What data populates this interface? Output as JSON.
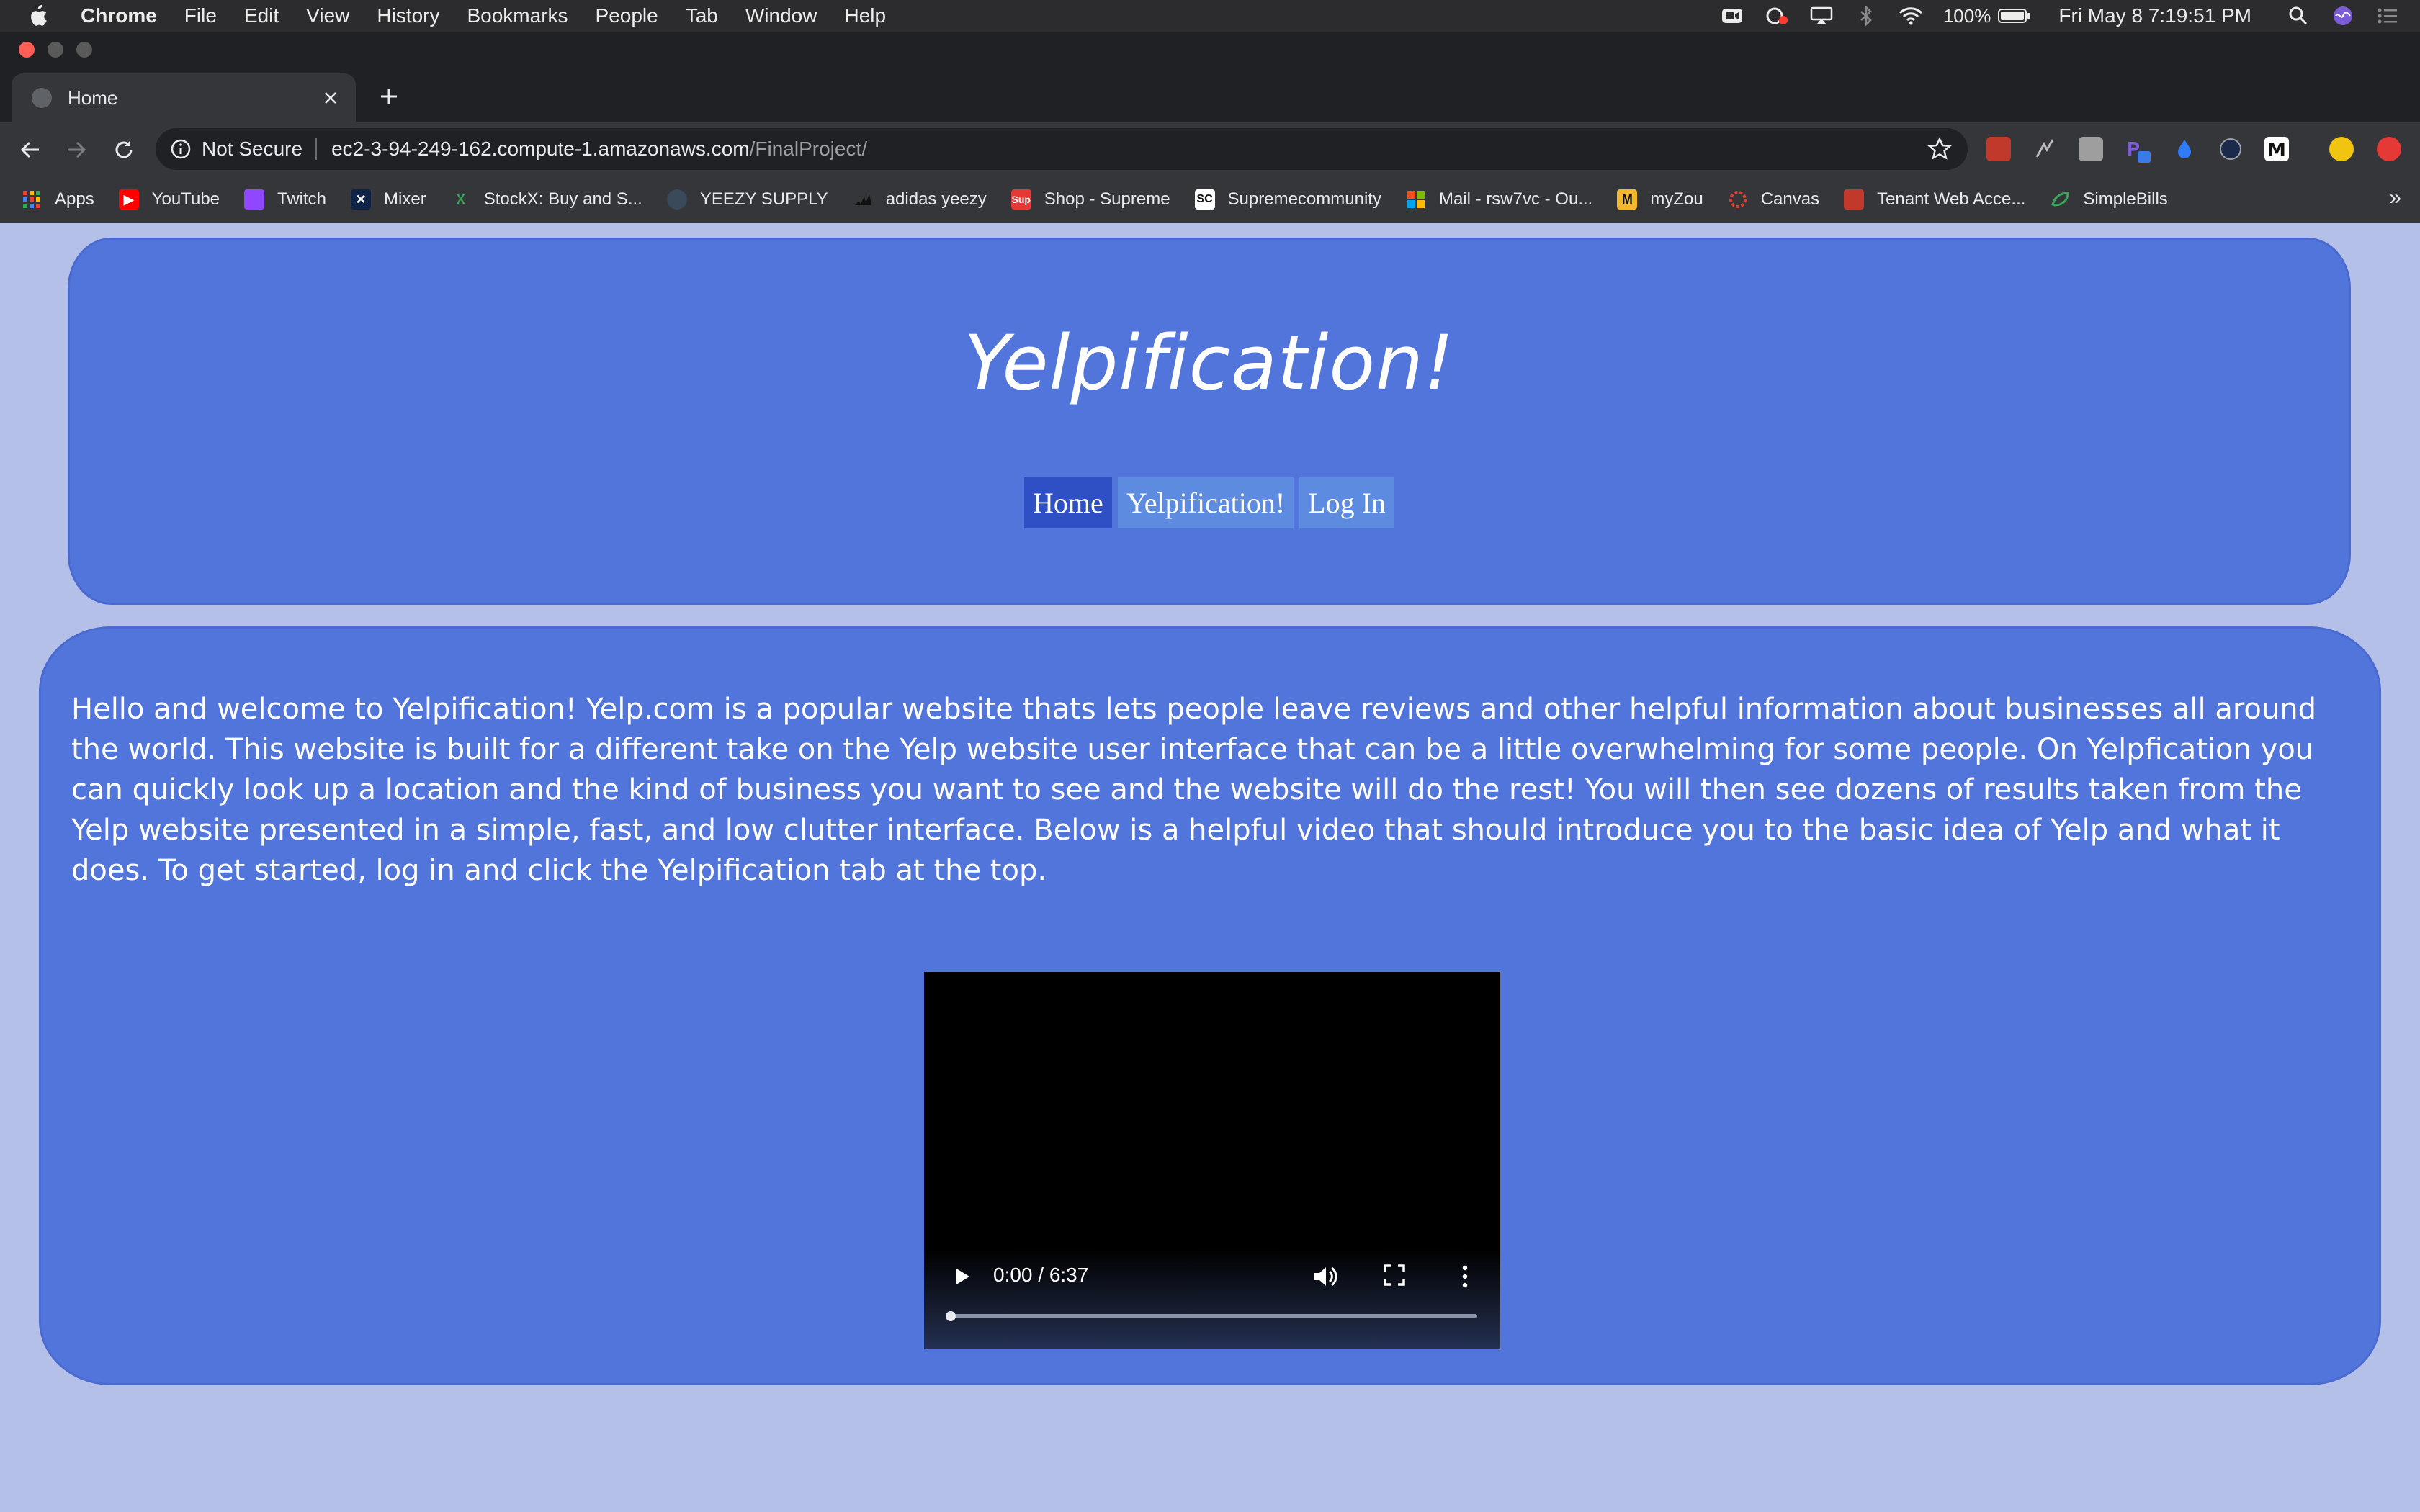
{
  "menubar": {
    "app_name": "Chrome",
    "items": [
      "File",
      "Edit",
      "View",
      "History",
      "Bookmarks",
      "People",
      "Tab",
      "Window",
      "Help"
    ],
    "battery": "100%",
    "clock": "Fri May 8  7:19:51 PM"
  },
  "browser": {
    "tab_title": "Home",
    "security_label": "Not Secure",
    "url_host": "ec2-3-94-249-162.compute-1.amazonaws.com",
    "url_path": "/FinalProject/",
    "bookmarks": [
      {
        "label": "Apps",
        "color": "#e94235"
      },
      {
        "label": "YouTube",
        "color": "#ff0000"
      },
      {
        "label": "Twitch",
        "color": "#9146ff"
      },
      {
        "label": "Mixer",
        "color": "#0f2346"
      },
      {
        "label": "StockX: Buy and S...",
        "color": "#2e7d32"
      },
      {
        "label": "YEEZY SUPPLY",
        "color": "#3b4a5a"
      },
      {
        "label": "adidas yeezy",
        "color": "#111111"
      },
      {
        "label": "Shop - Supreme",
        "color": "#e53935"
      },
      {
        "label": "Supremecommunity",
        "color": "#222222"
      },
      {
        "label": "Mail - rsw7vc - Ou...",
        "color": "#f25022"
      },
      {
        "label": "myZou",
        "color": "#f1b82d"
      },
      {
        "label": "Canvas",
        "color": "#e13f2b"
      },
      {
        "label": "Tenant Web Acce...",
        "color": "#c0392b"
      },
      {
        "label": "SimpleBills",
        "color": "#3aa655"
      }
    ],
    "bookmarks_overflow": "»"
  },
  "site": {
    "title": "Yelpification!",
    "nav": [
      {
        "label": "Home",
        "active": true
      },
      {
        "label": "Yelpification!",
        "active": false
      },
      {
        "label": "Log In",
        "active": false
      }
    ],
    "intro": "Hello and welcome to Yelpification! Yelp.com is a popular website thats lets people leave reviews and other helpful information about businesses all around the world. This website is built for a different take on the Yelp website user interface that can be a little overwhelming for some people. On Yelpfication you can quickly look up a location and the kind of business you want to see and the website will do the rest! You will then see dozens of results taken from the Yelp website presented in a simple, fast, and low clutter interface. Below is a helpful video that should introduce you to the basic idea of Yelp and what it does. To get started, log in and click the Yelpification tab at the top.",
    "video": {
      "time": "0:00 / 6:37",
      "progress": 0.0
    }
  }
}
